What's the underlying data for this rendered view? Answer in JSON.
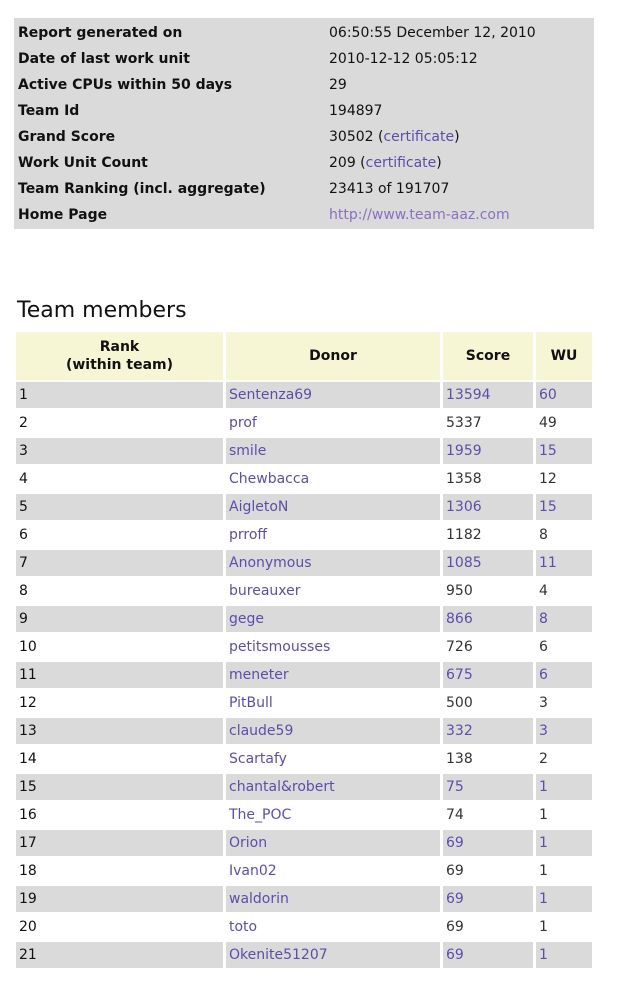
{
  "summary": {
    "rows": [
      {
        "label": "Report generated on",
        "value": "06:50:55 December 12, 2010"
      },
      {
        "label": "Date of last work unit",
        "value": "2010-12-12 05:05:12"
      },
      {
        "label": "Active CPUs within 50 days",
        "value": "29"
      },
      {
        "label": "Team Id",
        "value": "194897"
      },
      {
        "label": "Grand Score",
        "value": "30502 (",
        "link": "certificate",
        "suffix": ")"
      },
      {
        "label": "Work Unit Count",
        "value": "209 (",
        "link": "certificate",
        "suffix": ")"
      },
      {
        "label": "Team Ranking (incl. aggregate)",
        "value": "23413 of 191707"
      },
      {
        "label": "Home Page",
        "link_only": "http://www.team-aaz.com"
      }
    ]
  },
  "members": {
    "title": "Team members",
    "headers": {
      "rank": "Rank\n(within team)",
      "donor": "Donor",
      "score": "Score",
      "wu": "WU"
    },
    "rows": [
      {
        "rank": "1",
        "donor": "Sentenza69",
        "score": "13594",
        "wu": "60"
      },
      {
        "rank": "2",
        "donor": "prof",
        "score": "5337",
        "wu": "49"
      },
      {
        "rank": "3",
        "donor": "smile",
        "score": "1959",
        "wu": "15"
      },
      {
        "rank": "4",
        "donor": "Chewbacca",
        "score": "1358",
        "wu": "12"
      },
      {
        "rank": "5",
        "donor": "AigletoN",
        "score": "1306",
        "wu": "15"
      },
      {
        "rank": "6",
        "donor": "prroff",
        "score": "1182",
        "wu": "8"
      },
      {
        "rank": "7",
        "donor": "Anonymous",
        "score": "1085",
        "wu": "11"
      },
      {
        "rank": "8",
        "donor": "bureauxer",
        "score": "950",
        "wu": "4"
      },
      {
        "rank": "9",
        "donor": "gege",
        "score": "866",
        "wu": "8"
      },
      {
        "rank": "10",
        "donor": "petitsmousses",
        "score": "726",
        "wu": "6"
      },
      {
        "rank": "11",
        "donor": "meneter",
        "score": "675",
        "wu": "6"
      },
      {
        "rank": "12",
        "donor": "PitBull",
        "score": "500",
        "wu": "3"
      },
      {
        "rank": "13",
        "donor": "claude59",
        "score": "332",
        "wu": "3"
      },
      {
        "rank": "14",
        "donor": "Scartafy",
        "score": "138",
        "wu": "2"
      },
      {
        "rank": "15",
        "donor": "chantal&robert",
        "score": "75",
        "wu": "1"
      },
      {
        "rank": "16",
        "donor": "The_POC",
        "score": "74",
        "wu": "1"
      },
      {
        "rank": "17",
        "donor": "Orion",
        "score": "69",
        "wu": "1"
      },
      {
        "rank": "18",
        "donor": "Ivan02",
        "score": "69",
        "wu": "1"
      },
      {
        "rank": "19",
        "donor": "waldorin",
        "score": "69",
        "wu": "1"
      },
      {
        "rank": "20",
        "donor": "toto",
        "score": "69",
        "wu": "1"
      },
      {
        "rank": "21",
        "donor": "Okenite51207",
        "score": "69",
        "wu": "1"
      }
    ]
  }
}
